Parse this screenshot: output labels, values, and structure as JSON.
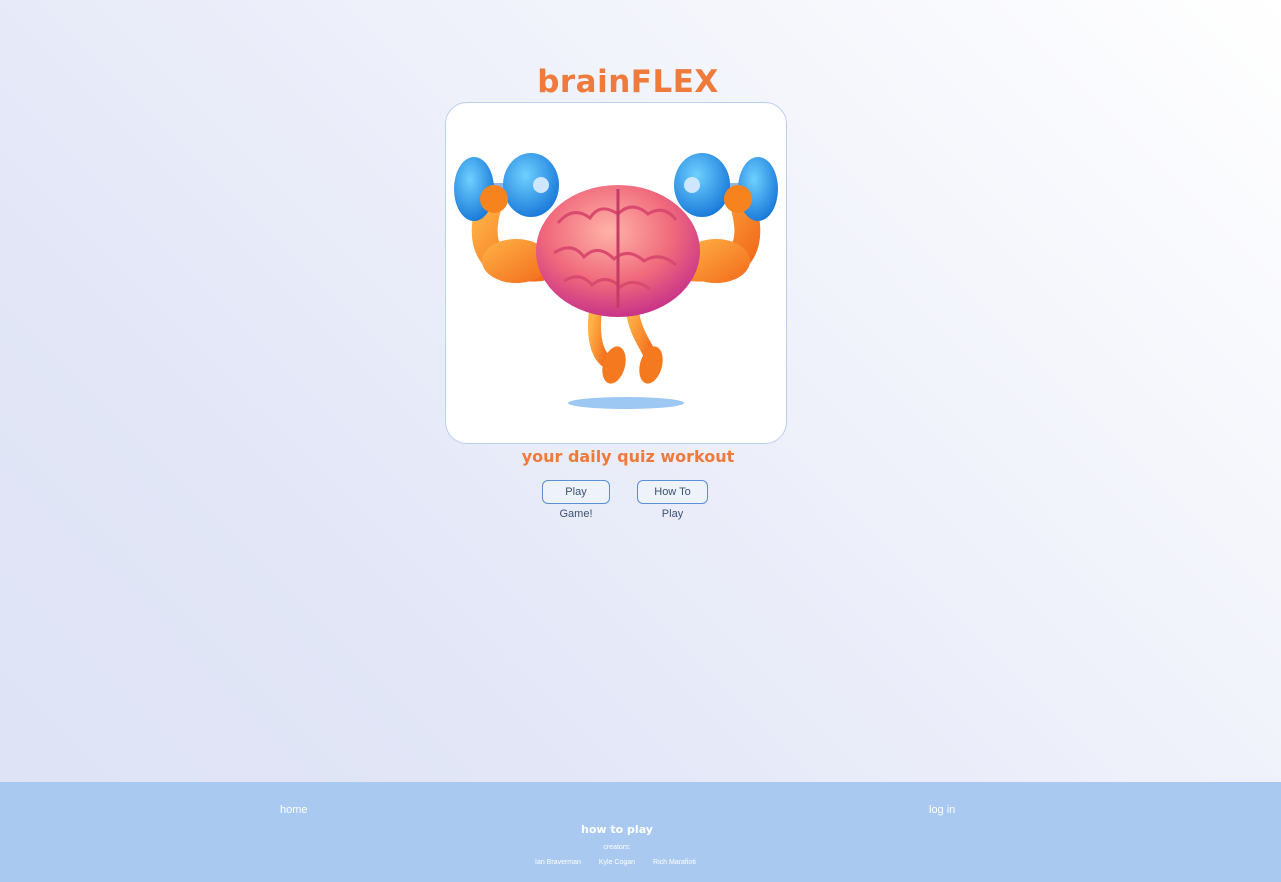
{
  "header": {
    "title": "brainFLEX"
  },
  "hero": {
    "image_icon": "flexing-brain-lifting-dumbbells",
    "tagline": "your daily quiz workout"
  },
  "actions": {
    "play_label": "Play Game!",
    "how_label": "How To Play"
  },
  "footer": {
    "home_label": "home",
    "login_label": "log in",
    "how_label": "how to play",
    "creators_label": "creators:",
    "creators": [
      "Ian Braverman",
      "Kyle Cogan",
      "Rich Marafioti"
    ]
  },
  "colors": {
    "brand_orange": "#ee7a3c",
    "footer_blue": "#a9c9f1",
    "button_border": "#5a8fd6"
  }
}
